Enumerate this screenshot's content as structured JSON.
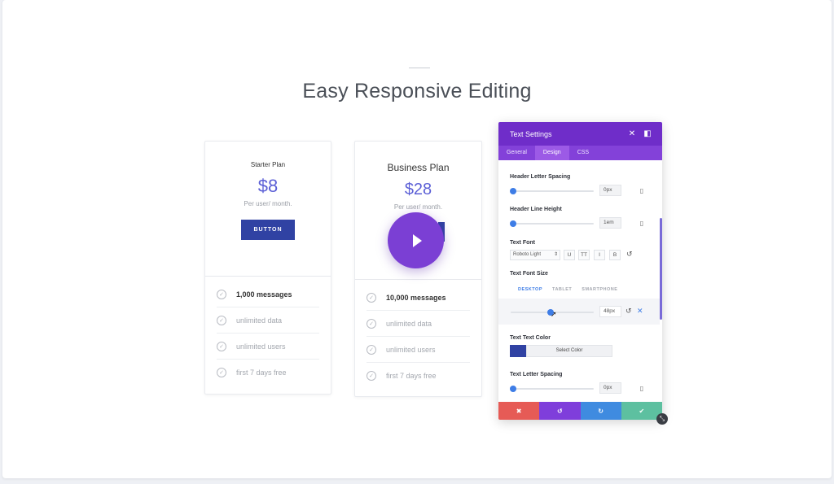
{
  "page": {
    "title": "Easy Responsive Editing"
  },
  "cards": [
    {
      "plan": "Starter Plan",
      "price": "$8",
      "per": "Per user/ month.",
      "button": "BUTTON",
      "features": [
        "1,000 messages",
        "unlimited data",
        "unlimited users",
        "first 7 days free"
      ]
    },
    {
      "plan": "Business Plan",
      "price": "$28",
      "per": "Per user/ month.",
      "features": [
        "10,000 messages",
        "unlimited data",
        "unlimited users",
        "first 7 days free"
      ]
    }
  ],
  "play": {
    "icon": "play-icon"
  },
  "panel": {
    "title": "Text Settings",
    "tabs": [
      "General",
      "Design",
      "CSS"
    ],
    "active_tab": "Design",
    "header_letter_spacing": {
      "label": "Header Letter Spacing",
      "value": "0px",
      "level": 0
    },
    "header_line_height": {
      "label": "Header Line Height",
      "value": "1em",
      "level": 0
    },
    "text_font": {
      "label": "Text Font",
      "value": "Roboto Light",
      "buttons": [
        "U",
        "TT",
        "I",
        "B"
      ]
    },
    "text_font_size": {
      "label": "Text Font Size",
      "devices": [
        "DESKTOP",
        "TABLET",
        "SMARTPHONE"
      ],
      "active_device": "DESKTOP",
      "value": "48px",
      "level": 0.48
    },
    "text_color": {
      "label": "Text Text Color",
      "button": "Select Color",
      "swatch": "#3042a3"
    },
    "text_letter_spacing": {
      "label": "Text Letter Spacing",
      "value": "0px",
      "level": 0
    },
    "actions": [
      "✖",
      "↺",
      "↻",
      "✔"
    ]
  },
  "colors": {
    "accent": "#6f2dc9",
    "button": "#3042a3",
    "price": "#5b5fd6",
    "cancel": "#e65b56",
    "undo": "#7f3edb",
    "redo": "#3f8be0",
    "save": "#5dc0a0"
  }
}
